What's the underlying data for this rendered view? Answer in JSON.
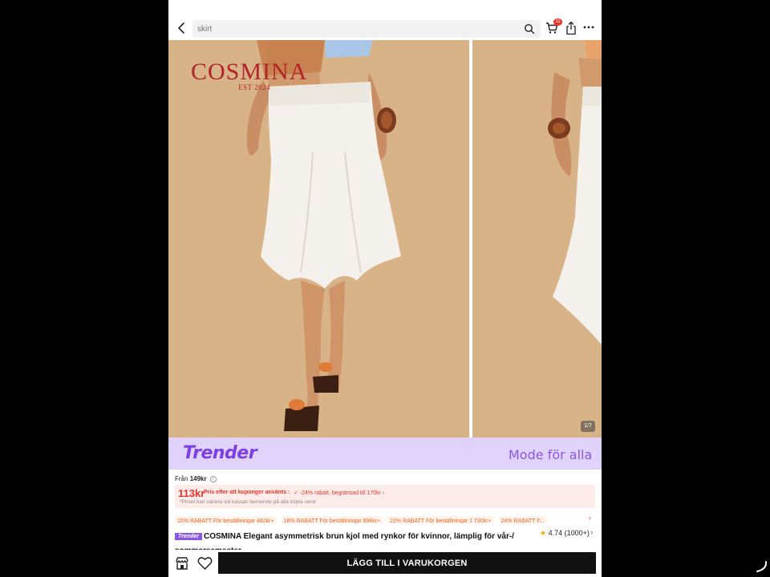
{
  "search": {
    "placeholder": "skirt"
  },
  "header": {
    "cart_count": "11"
  },
  "gallery": {
    "brand": "COSMINA",
    "brand_est": "EST 2024",
    "counter": "1/7"
  },
  "banner": {
    "logo": "Trender",
    "tagline": "Mode för alla"
  },
  "price": {
    "from_label": "Från",
    "from_value": "149kr",
    "coupon_price": "113kr",
    "coupon_label": "Pris efter att kuponger använts :",
    "coupon_discount": "✓ -24% rabatt, begränsad till 170kr ›",
    "coupon_note": "*Priset kan variera vid kassan beroende på alla köpta varor"
  },
  "discounts": [
    "16% RABATT För beställningar 482kr+",
    "18% RABATT För beställningar 898kr+",
    "22% RABATT För beställningar 1 730kr+",
    "24% RABATT F..."
  ],
  "product": {
    "badge": "Trender",
    "title": "COSMINA Elegant asymmetrisk brun kjol med rynkor för kvinnor, lämplig för vår-/ sommarsemester",
    "rating": "4.74",
    "rating_count": "(1000+)"
  },
  "actions": {
    "add_to_cart": "LÄGG TILL I VARUKORGEN"
  },
  "colors": {
    "accent_red": "#e8342d",
    "banner_bg": "#e1d2fb",
    "banner_purple": "#7b3fe4",
    "photo_bg": "#d9b489",
    "discount_orange": "#f0661f"
  }
}
